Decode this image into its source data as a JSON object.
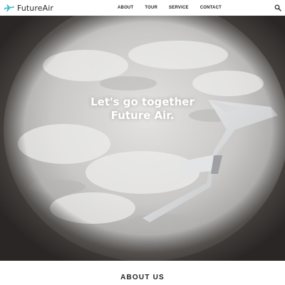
{
  "brand": {
    "name": "FutureAir",
    "icon": "airplane-logo-icon",
    "color": "#3fb8c9"
  },
  "nav": {
    "items": [
      {
        "label": "ABOUT"
      },
      {
        "label": "TOUR"
      },
      {
        "label": "SERVICE"
      },
      {
        "label": "CONTACT"
      }
    ],
    "search_icon": "search-icon"
  },
  "hero": {
    "line1": "Let's go together",
    "line2": "Future Air."
  },
  "about": {
    "title": "ABOUT US"
  }
}
